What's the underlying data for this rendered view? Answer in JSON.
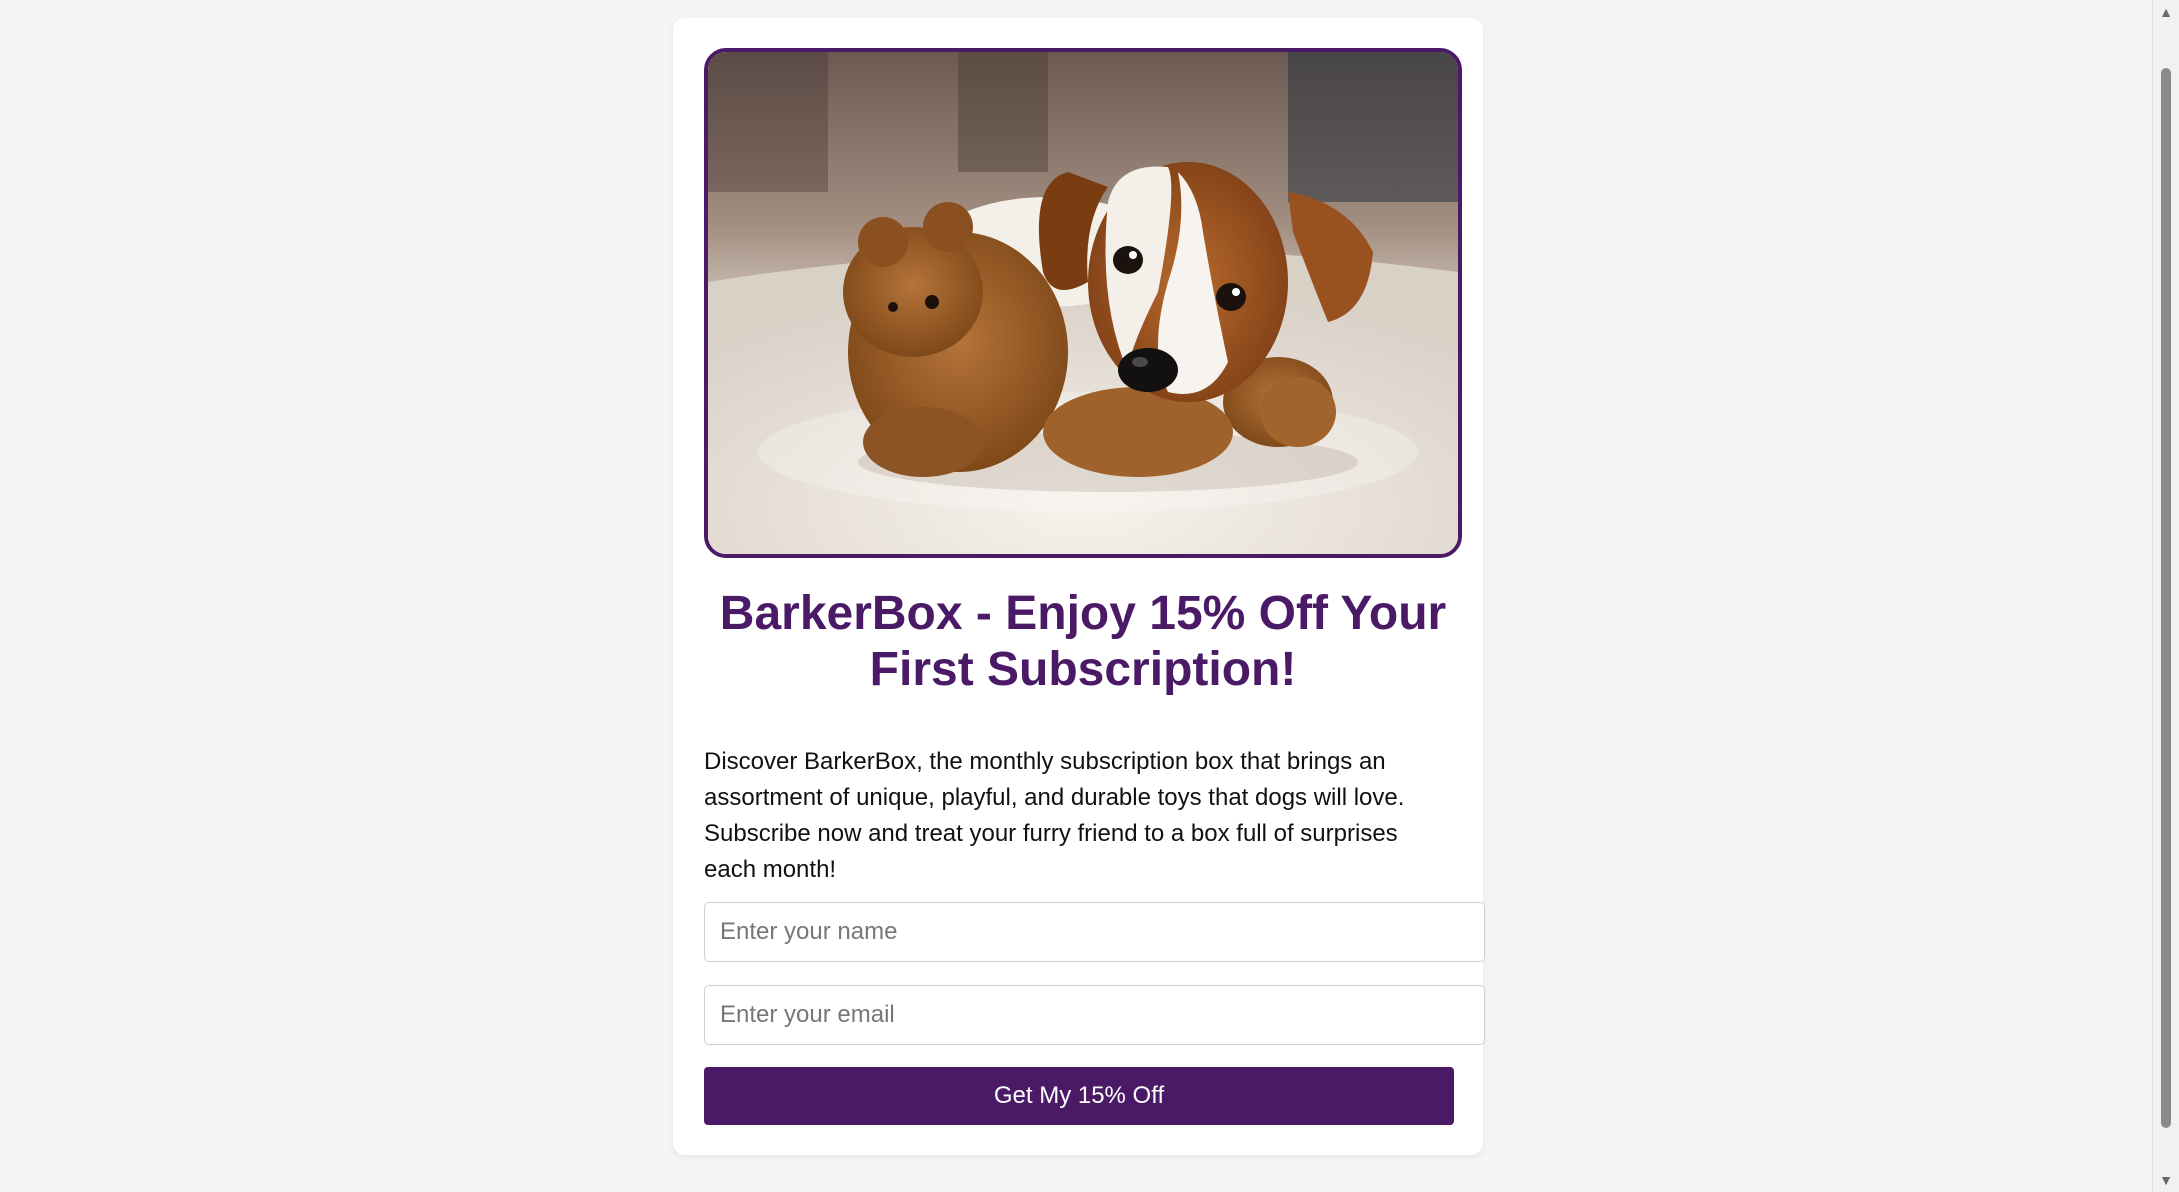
{
  "hero": {
    "image_alt": "Puppy lying on a white rug with a brown teddy bear",
    "frame_color": "#4a1a67"
  },
  "title": "BarkerBox - Enjoy 15% Off Your First Subscription!",
  "description": "Discover BarkerBox, the monthly subscription box that brings an assortment of unique, playful, and durable toys that dogs will love. Subscribe now and treat your furry friend to a box full of surprises each month!",
  "form": {
    "name_placeholder": "Enter your name",
    "name_value": "",
    "email_placeholder": "Enter your email",
    "email_value": "",
    "submit_label": "Get My 15% Off"
  },
  "colors": {
    "accent": "#4a1a67",
    "background": "#f5f5f5",
    "card": "#ffffff"
  },
  "scrollbar": {
    "up_icon": "chevron-up-icon",
    "down_icon": "chevron-down-icon"
  }
}
